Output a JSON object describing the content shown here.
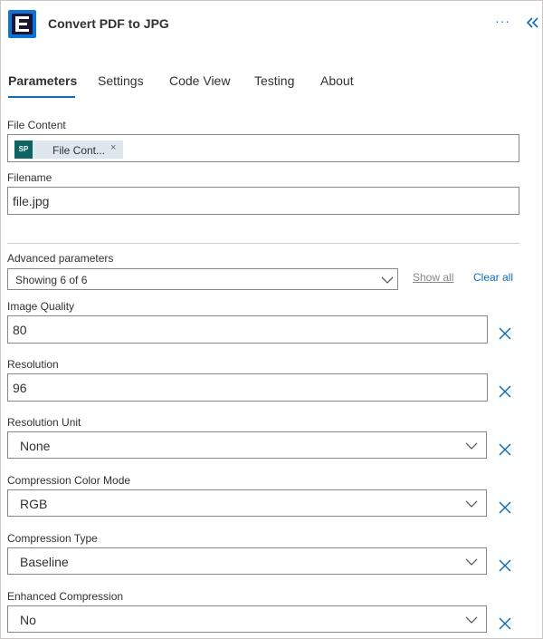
{
  "header": {
    "title": "Convert PDF to JPG",
    "more_glyph": "···",
    "icons": {
      "app": "app-logo-icon",
      "more": "more-icon",
      "collapse": "double-chevron-left-icon"
    }
  },
  "tabs": [
    {
      "label": "Parameters",
      "active": true
    },
    {
      "label": "Settings",
      "active": false
    },
    {
      "label": "Code View",
      "active": false
    },
    {
      "label": "Testing",
      "active": false
    },
    {
      "label": "About",
      "active": false
    }
  ],
  "fields": {
    "file_content": {
      "label": "File Content",
      "token": {
        "icon_text": "SP",
        "label": "File Cont...",
        "remove_glyph": "×"
      }
    },
    "filename": {
      "label": "Filename",
      "value": "file.jpg"
    }
  },
  "advanced": {
    "label": "Advanced parameters",
    "selected": "Showing 6 of 6",
    "show_all": "Show all",
    "clear_all": "Clear all"
  },
  "params": [
    {
      "label": "Image Quality",
      "value": "80",
      "kind": "text"
    },
    {
      "label": "Resolution",
      "value": "96",
      "kind": "text"
    },
    {
      "label": "Resolution Unit",
      "value": "None",
      "kind": "dropdown"
    },
    {
      "label": "Compression Color Mode",
      "value": "RGB",
      "kind": "dropdown"
    },
    {
      "label": "Compression Type",
      "value": "Baseline",
      "kind": "dropdown"
    },
    {
      "label": "Enhanced Compression",
      "value": "No",
      "kind": "dropdown"
    }
  ],
  "colors": {
    "accent": "#0f6cbd",
    "border": "#8a8886",
    "text": "#323130",
    "token_bg": "#dee7ee",
    "sharepoint": "#0f6361"
  }
}
